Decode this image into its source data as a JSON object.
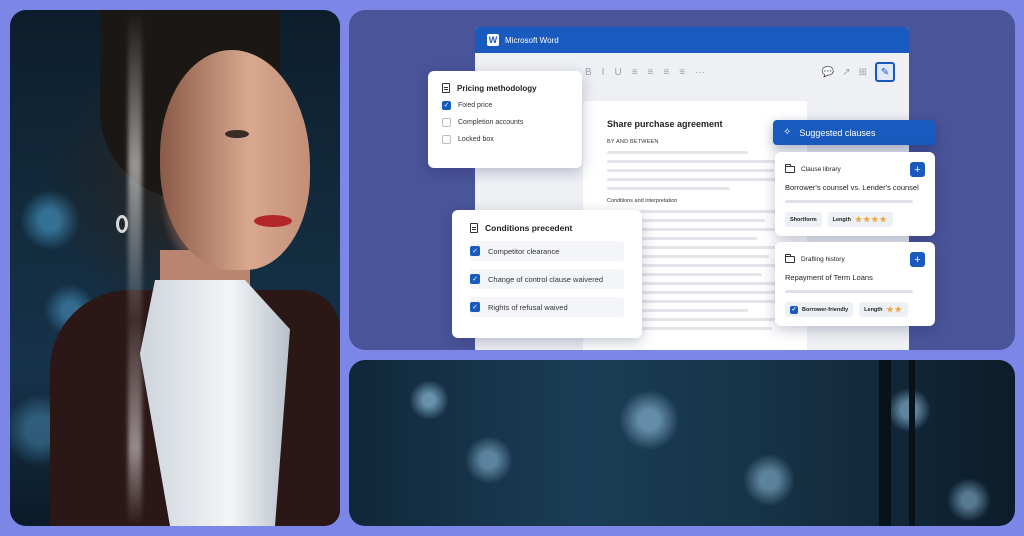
{
  "word": {
    "app_title": "Microsoft Word",
    "logo_letter": "W",
    "toolbar": [
      "B",
      "I",
      "U",
      "≡",
      "≡",
      "≡",
      "≡",
      "···"
    ],
    "toolbar_right": [
      "💬",
      "↗",
      "⊞"
    ],
    "ai_button_icon": "✎"
  },
  "document": {
    "title": "Share purchase agreement",
    "by_between": "BY AND BETWEEN",
    "section": "Conditions and interpretation"
  },
  "pricing": {
    "title": "Pricing methodology",
    "options": [
      {
        "label": "Fixed price",
        "checked": true
      },
      {
        "label": "Completion accounts",
        "checked": false
      },
      {
        "label": "Locked box",
        "checked": false
      }
    ]
  },
  "conditions": {
    "title": "Conditions precedent",
    "items": [
      {
        "label": "Competitor clearance",
        "checked": true
      },
      {
        "label": "Change of control clause waivered",
        "checked": true
      },
      {
        "label": "Rights of refusal waived",
        "checked": true
      }
    ]
  },
  "suggested": {
    "label": "Suggested clauses",
    "icon": "sparkle-icon"
  },
  "clause_library": {
    "label": "Clause library",
    "title": "Borrower's counsel vs. Lender's counsel",
    "tags": [
      "Shortform",
      "Length"
    ],
    "length_stars": "★★★★"
  },
  "drafting_history": {
    "label": "Drafting history",
    "title": "Repayment of Term Loans",
    "tags": [
      "Borrower-friendly",
      "Length"
    ],
    "length_stars": "★★"
  },
  "colors": {
    "background": "#7b86e6",
    "panel": "#4a5499",
    "accent": "#185abd",
    "star": "#f0a43a"
  }
}
